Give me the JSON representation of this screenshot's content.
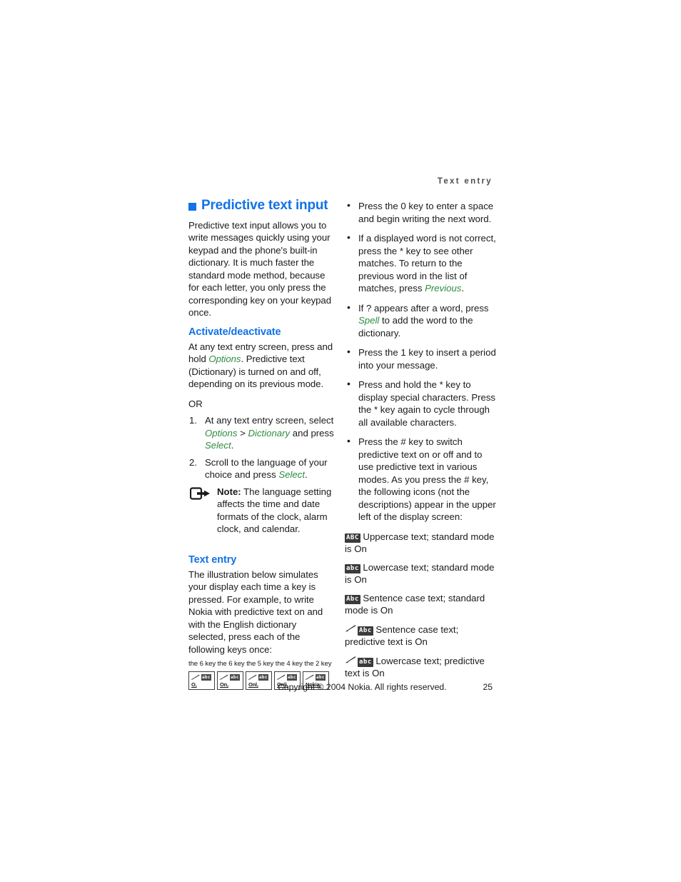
{
  "page": {
    "running_header": "Text entry",
    "page_number": "25",
    "footer_copyright": "Copyright © 2004 Nokia. All rights reserved.",
    "accent_blue": "#1272e8",
    "accent_green": "#2f8c3f",
    "body_color": "#1a1a1a"
  },
  "left_column": {
    "heading": "Predictive text input",
    "intro": "Predictive text input allows you to write messages quickly using your keypad and the phone's built-in dictionary. It is much faster the standard mode method, because for each letter, you only press the corresponding key on your keypad once.",
    "activate": {
      "heading": "Activate/deactivate",
      "para_1_a": "At any text entry screen, press and hold ",
      "para_1_italic": "Options",
      "para_1_b": ". Predictive text (Dictionary) is turned on and off, depending on its previous mode.",
      "or": "OR",
      "steps": [
        {
          "num": "1.",
          "a": "At any text entry screen, select ",
          "i1": "Options",
          "b": " > ",
          "i2": "Dictionary",
          "c": " and press ",
          "i3": "Select",
          "d": "."
        },
        {
          "num": "2.",
          "a": "Scroll to the language of your choice and press ",
          "i1": "Select",
          "b": "."
        }
      ],
      "note": {
        "icon": "note-arrow-icon",
        "label": "Note:",
        "text": " The language setting affects the time and date formats of the clock, alarm clock, and calendar."
      }
    },
    "text_entry": {
      "heading": "Text entry",
      "para": "The illustration below simulates your display each time a key is pressed. For example, to write Nokia with predictive text on and with the English dictionary selected, press each of the following keys once:",
      "key_caption": "the 6 key the 6 key the 5 key the 4 key the 2 key",
      "displays": [
        {
          "icon_pred": "pencil-lines-icon",
          "icon_mode": "abc",
          "word": "O,"
        },
        {
          "icon_pred": "pencil-lines-icon",
          "icon_mode": "abc",
          "word": "On,"
        },
        {
          "icon_pred": "pencil-lines-icon",
          "icon_mode": "abc",
          "word": "Onl,"
        },
        {
          "icon_pred": "pencil-lines-icon",
          "icon_mode": "abc",
          "word": "Onli,"
        },
        {
          "icon_pred": "pencil-lines-icon",
          "icon_mode": "abc",
          "word": "Nokia,"
        }
      ]
    }
  },
  "right_column": {
    "bullets": [
      {
        "a": "Press the 0 key to enter a space and begin writing the next word.",
        "i1": "",
        "b": "",
        "i2": "",
        "c": ""
      },
      {
        "a": "If a displayed word is not correct, press the * key to see other matches. To return to the previous word in the list of matches, press ",
        "i1": "Previous",
        "b": ".",
        "i2": "",
        "c": ""
      },
      {
        "a": "If ? appears after a word, press ",
        "i1": "Spell",
        "b": " to add the word to the dictionary.",
        "i2": "",
        "c": ""
      },
      {
        "a": "Press the 1 key to insert a period into your message.",
        "i1": "",
        "b": "",
        "i2": "",
        "c": ""
      },
      {
        "a": "Press and hold the * key to display special characters. Press the * key again to cycle through all available characters.",
        "i1": "",
        "b": "",
        "i2": "",
        "c": ""
      },
      {
        "a": "Press the # key to switch predictive text on or off and to use predictive text in various modes. As you press the # key, the following icons (not the descriptions) appear in the upper left of the display screen:",
        "i1": "",
        "b": "",
        "i2": "",
        "c": ""
      }
    ],
    "legend": [
      {
        "pred": false,
        "mode": "ABC",
        "text": " Uppercase text; standard mode is On"
      },
      {
        "pred": false,
        "mode": "abc",
        "text": " Lowercase text; standard mode is On"
      },
      {
        "pred": false,
        "mode": "Abc",
        "text": " Sentence case text; standard mode is On"
      },
      {
        "pred": true,
        "mode": "Abc",
        "text": " Sentence case text; predictive text is On"
      },
      {
        "pred": true,
        "mode": "abc",
        "text": " Lowercase text; predictive text is On"
      }
    ]
  }
}
